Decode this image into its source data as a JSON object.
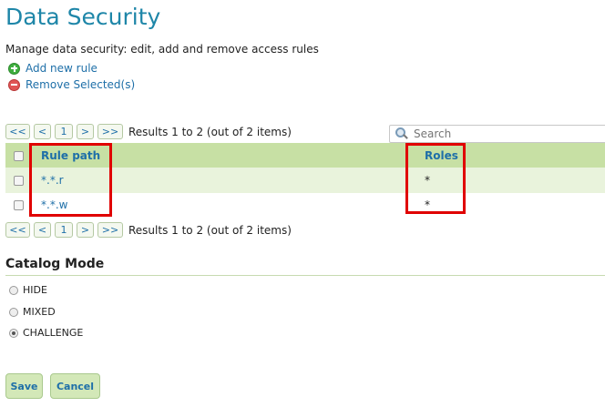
{
  "header": {
    "title": "Data Security",
    "description": "Manage data security: edit, add and remove access rules"
  },
  "actions": {
    "add_label": "Add new rule",
    "remove_label": "Remove Selected(s)"
  },
  "pager": {
    "first": "<<",
    "prev": "<",
    "page": "1",
    "next": ">",
    "last": ">>",
    "info": "Results 1 to 2 (out of 2 items)"
  },
  "search": {
    "placeholder": "Search"
  },
  "table": {
    "columns": [
      "Rule path",
      "Roles"
    ],
    "rows": [
      {
        "path": "*.*.r",
        "roles": "*"
      },
      {
        "path": "*.*.w",
        "roles": "*"
      }
    ]
  },
  "catalog_mode": {
    "title": "Catalog Mode",
    "options": [
      "HIDE",
      "MIXED",
      "CHALLENGE"
    ],
    "selected": "CHALLENGE"
  },
  "form": {
    "save_label": "Save",
    "cancel_label": "Cancel"
  },
  "colors": {
    "accent": "#1e86a8",
    "header_bg": "#c7e0a4",
    "highlight_box": "#e00000"
  }
}
